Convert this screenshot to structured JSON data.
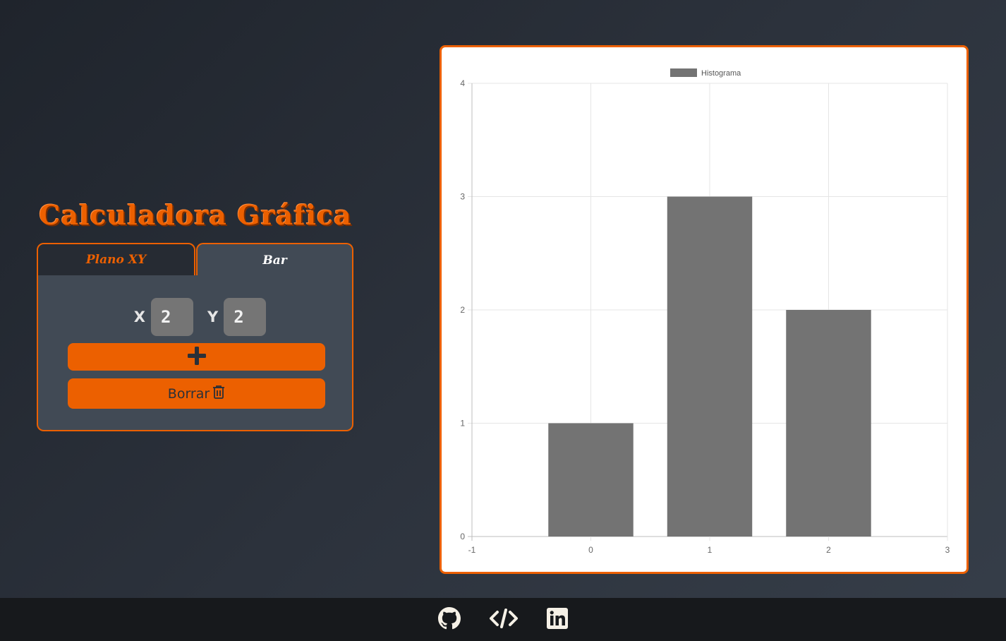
{
  "app": {
    "title": "Calculadora Gráfica"
  },
  "tabs": [
    {
      "label": "Plano XY",
      "active": false
    },
    {
      "label": "Bar",
      "active": true
    }
  ],
  "form": {
    "x_label": "X",
    "x_value": "2",
    "y_label": "Y",
    "y_value": "2",
    "add_icon": "plus-icon",
    "clear_label": "Borrar",
    "clear_icon": "trash-icon"
  },
  "footer": {
    "links": [
      {
        "icon": "github-icon"
      },
      {
        "icon": "code-icon"
      },
      {
        "icon": "linkedin-icon"
      }
    ]
  },
  "colors": {
    "accent": "#ec6000",
    "bar": "#737373",
    "panel": "#414a55",
    "footer": "#17191c"
  },
  "chart_data": {
    "type": "bar",
    "title": "",
    "xlabel": "",
    "ylabel": "",
    "x": [
      0,
      1,
      2
    ],
    "series": [
      {
        "name": "Histograma",
        "values": [
          1,
          3,
          2
        ],
        "color": "#737373"
      }
    ],
    "xlim": [
      -1,
      3
    ],
    "ylim": [
      0,
      4
    ],
    "xticks": [
      "-1",
      "0",
      "1",
      "2",
      "3"
    ],
    "yticks": [
      "0",
      "1",
      "2",
      "3",
      "4"
    ],
    "grid": true,
    "legend_position": "top-center"
  }
}
